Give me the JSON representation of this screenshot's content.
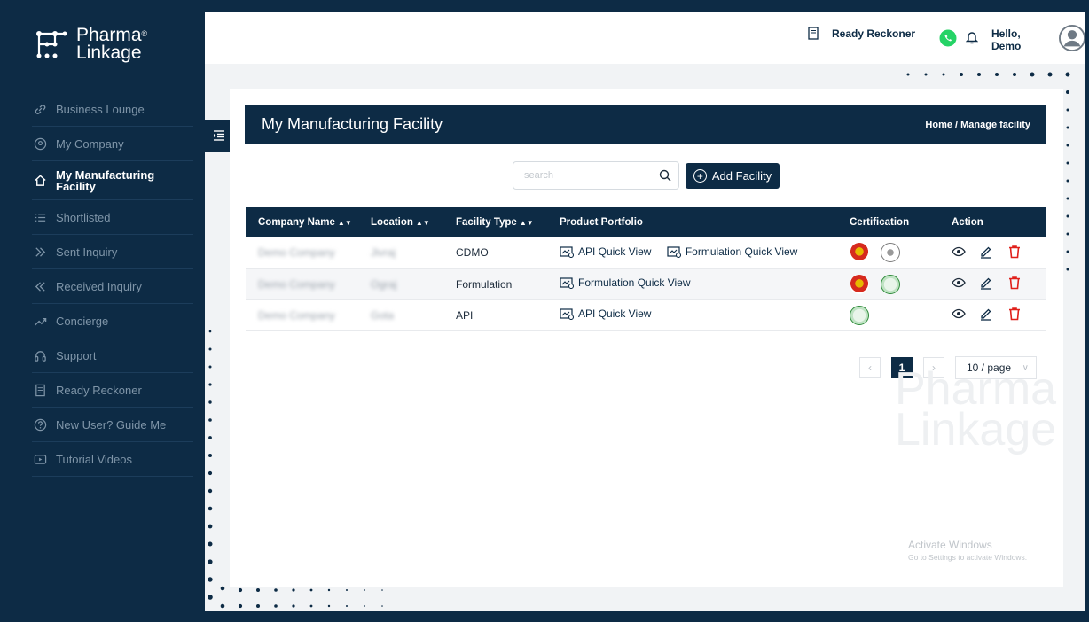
{
  "brand": {
    "name_line1": "Pharma",
    "name_line2": "Linkage",
    "reg": "®"
  },
  "sidebar": {
    "items": [
      {
        "label": "Business Lounge",
        "icon": "link-icon"
      },
      {
        "label": "My Company",
        "icon": "location-pin-icon"
      },
      {
        "label": "My Manufacturing Facility",
        "icon": "home-icon",
        "active": true
      },
      {
        "label": "Shortlisted",
        "icon": "list-icon"
      },
      {
        "label": "Sent Inquiry",
        "icon": "double-chevron-right-icon"
      },
      {
        "label": "Received Inquiry",
        "icon": "double-chevron-left-icon"
      },
      {
        "label": "Concierge",
        "icon": "trend-icon"
      },
      {
        "label": "Support",
        "icon": "headset-icon"
      },
      {
        "label": "Ready Reckoner",
        "icon": "document-icon"
      },
      {
        "label": "New User? Guide Me",
        "icon": "help-circle-icon"
      },
      {
        "label": "Tutorial Videos",
        "icon": "play-icon"
      }
    ]
  },
  "header": {
    "ready_reckoner": "Ready Reckoner",
    "greeting": "Hello, Demo"
  },
  "page": {
    "title": "My Manufacturing Facility",
    "breadcrumb": "Home / Manage facility"
  },
  "search": {
    "placeholder": "search"
  },
  "add_button": "Add Facility",
  "table": {
    "columns": [
      "Company Name",
      "Location",
      "Facility Type",
      "Product Portfolio",
      "Certification",
      "Action"
    ],
    "rows": [
      {
        "company": "Demo Company",
        "location": "Jivraj",
        "facility_type": "CDMO",
        "portfolio": [
          "API Quick View",
          "Formulation Quick View"
        ]
      },
      {
        "company": "Demo Company",
        "location": "Ograj",
        "facility_type": "Formulation",
        "portfolio": [
          "Formulation Quick View"
        ]
      },
      {
        "company": "Demo Company",
        "location": "Gota",
        "facility_type": "API",
        "portfolio": [
          "API Quick View"
        ]
      }
    ]
  },
  "pagination": {
    "current": "1",
    "per_page": "10 / page"
  },
  "watermark": {
    "line1": "Pharma",
    "line2": "Linkage"
  },
  "os_notice": {
    "title": "Activate Windows",
    "subtitle": "Go to Settings to activate Windows."
  },
  "colors": {
    "navy": "#0d2b45",
    "delete": "#e0201b",
    "whatsapp": "#25d366"
  }
}
